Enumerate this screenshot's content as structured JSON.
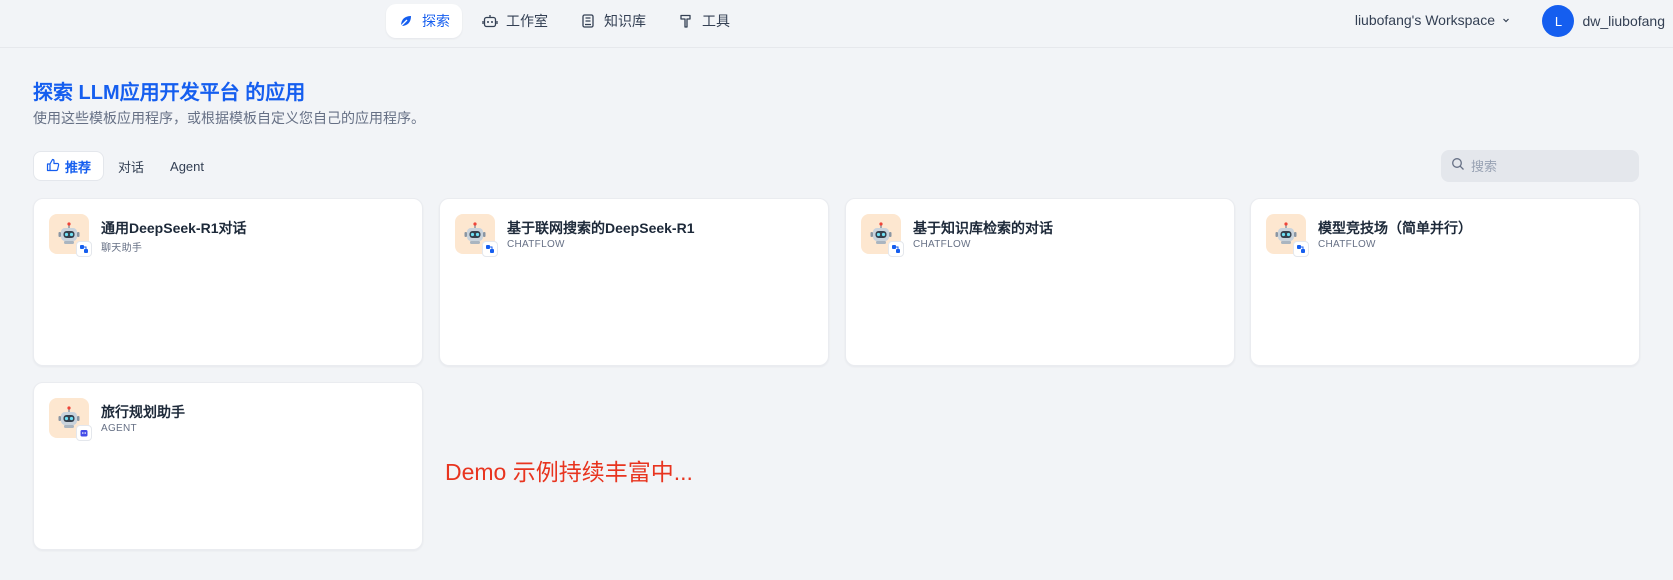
{
  "nav": {
    "items": [
      {
        "label": "探索",
        "icon": "explore-leaf-icon",
        "active": true
      },
      {
        "label": "工作室",
        "icon": "robot-icon",
        "active": false
      },
      {
        "label": "知识库",
        "icon": "book-icon",
        "active": false
      },
      {
        "label": "工具",
        "icon": "hammer-icon",
        "active": false
      }
    ]
  },
  "workspace": {
    "label": "liubofang's Workspace"
  },
  "user": {
    "avatar_initial": "L",
    "name": "dw_liubofang"
  },
  "header": {
    "title": "探索 LLM应用开发平台 的应用",
    "subtitle": "使用这些模板应用程序，或根据模板自定义您自己的应用程序。"
  },
  "tabs": [
    {
      "label": "推荐",
      "active": true
    },
    {
      "label": "对话",
      "active": false
    },
    {
      "label": "Agent",
      "active": false
    }
  ],
  "search": {
    "placeholder": "搜索",
    "value": ""
  },
  "apps": [
    {
      "name": "通用DeepSeek-R1对话",
      "type": "聊天助手",
      "icon": "robot-face-icon",
      "badge": "chatflow-icon"
    },
    {
      "name": "基于联网搜索的DeepSeek-R1",
      "type": "CHATFLOW",
      "icon": "robot-face-icon",
      "badge": "chatflow-icon"
    },
    {
      "name": "基于知识库检索的对话",
      "type": "CHATFLOW",
      "icon": "robot-face-icon",
      "badge": "chatflow-icon"
    },
    {
      "name": "模型竞技场（简单并行）",
      "type": "CHATFLOW",
      "icon": "robot-face-icon",
      "badge": "chatflow-icon"
    },
    {
      "name": "旅行规划助手",
      "type": "AGENT",
      "icon": "robot-face-icon",
      "badge": "agent-icon"
    }
  ],
  "note": "Demo 示例持续丰富中...",
  "colors": {
    "accent": "#155eef",
    "note": "#e8341f",
    "icon_bg": "#fde7d0",
    "page_bg": "#f2f4f7"
  }
}
